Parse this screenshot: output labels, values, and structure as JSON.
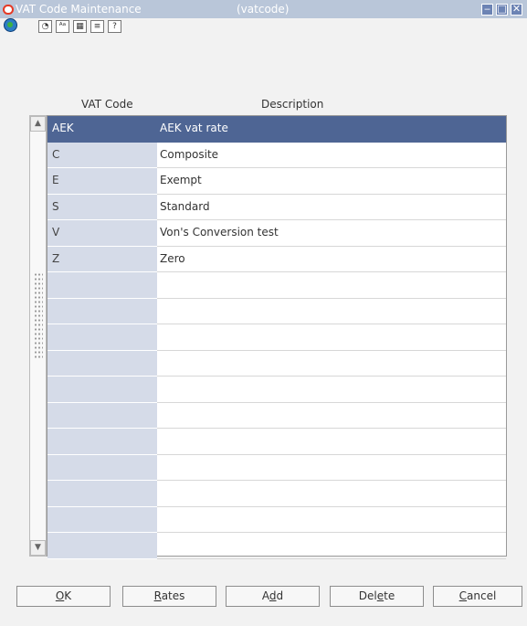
{
  "window": {
    "title": "VAT Code Maintenance",
    "subtitle": "(vatcode)",
    "minimize": "‒",
    "maximize": "□",
    "close": "✕"
  },
  "toolbar": {
    "icons": [
      "globe-icon",
      "clock-icon",
      "font-icon",
      "calendar-icon",
      "notes-icon",
      "help-icon"
    ],
    "labels": [
      "",
      "◔",
      "ᴬᵃ",
      "▦",
      "≡",
      "?"
    ]
  },
  "grid": {
    "columns": [
      "VAT Code",
      "Description"
    ],
    "rows": [
      {
        "code": "AEK",
        "description": "AEK vat rate",
        "selected": true
      },
      {
        "code": "C",
        "description": "Composite"
      },
      {
        "code": "E",
        "description": "Exempt"
      },
      {
        "code": "S",
        "description": "Standard"
      },
      {
        "code": "V",
        "description": "Von's Conversion test"
      },
      {
        "code": "Z",
        "description": "Zero"
      }
    ],
    "empty_rows": 11,
    "scroll_up": "▲",
    "scroll_down": "▼"
  },
  "buttons": {
    "ok": {
      "before": "",
      "mnemonic": "O",
      "after": "K"
    },
    "rates": {
      "before": "",
      "mnemonic": "R",
      "after": "ates"
    },
    "add": {
      "before": "A",
      "mnemonic": "d",
      "after": "d"
    },
    "delete": {
      "before": "Del",
      "mnemonic": "e",
      "after": "te"
    },
    "cancel": {
      "before": "",
      "mnemonic": "C",
      "after": "ancel"
    }
  }
}
